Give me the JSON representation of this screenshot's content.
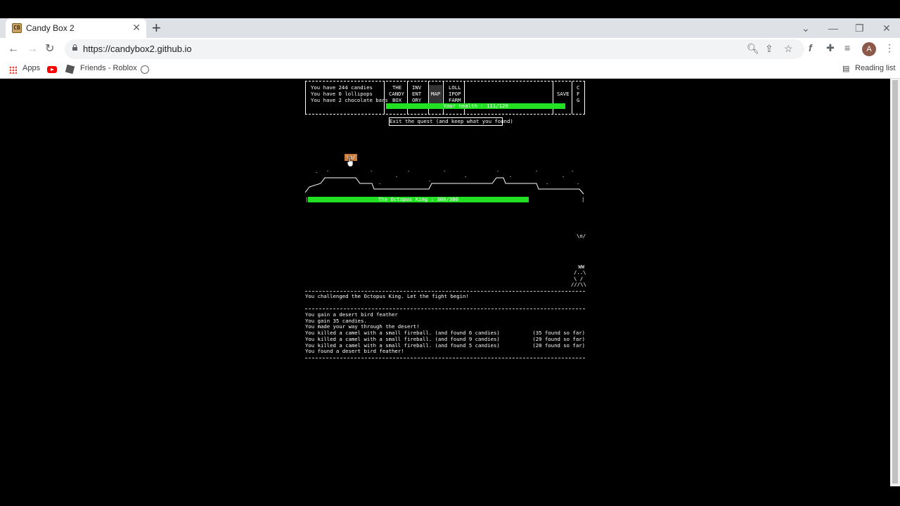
{
  "browser": {
    "tab_title": "Candy Box 2",
    "favicon_text": "CB",
    "url": "https://candybox2.github.io",
    "bookmarks": [
      {
        "label": "Apps",
        "icon": "apps-grid-icon"
      },
      {
        "label": "",
        "icon": "youtube-icon"
      },
      {
        "label": "Friends - Roblox",
        "icon": "roblox-icon"
      },
      {
        "label": "",
        "icon": "globe-icon"
      }
    ],
    "reading_list": "Reading list",
    "profile_initial": "A"
  },
  "status": {
    "candies": "You have 244 candies",
    "lollipops": "You have 0 lollipops",
    "chocolate": "You have 2 chocolate bars"
  },
  "tabs": [
    {
      "line1": "THE",
      "line2": "CANDY",
      "line3": "BOX"
    },
    {
      "line1": "INV",
      "line2": "ENT",
      "line3": "ORY"
    },
    {
      "line1": "",
      "line2": "MAP",
      "line3": ""
    },
    {
      "line1": "LOLL",
      "line2": "IPOP",
      "line3": "FARM"
    }
  ],
  "save_label": "SAVE",
  "cfg": [
    "C",
    "F",
    "G"
  ],
  "player_health": {
    "label": "Your health : 111/120",
    "fraction": 0.925
  },
  "exit_quest": "Exit the quest (and keep what you found)",
  "player_sprite": "\\o/",
  "enemy_health": {
    "label": "The Octopus King : 300/300",
    "fraction": 1.0
  },
  "creature_top": "\\o/",
  "creature_body": [
    " WW",
    "/..\\",
    "\\ /",
    "///\\\\"
  ],
  "challenge_message": "You challenged the Octopus King. Let the fight begin!",
  "log": [
    {
      "text": "You gain a desert bird feather",
      "right": ""
    },
    {
      "text": "You gain 35 candies.",
      "right": ""
    },
    {
      "text": "You made your way through the desert!",
      "right": ""
    },
    {
      "text": "You killed a camel with a small fireball. (and found 6 candies)",
      "right": "(35 found so far)"
    },
    {
      "text": "You killed a camel with a small fireball. (and found 9 candies)",
      "right": "(29 found so far)"
    },
    {
      "text": "You killed a camel with a small fireball. (and found 5 candies)",
      "right": "(20 found so far)"
    },
    {
      "text": "You found a desert bird feather!",
      "right": ""
    }
  ]
}
